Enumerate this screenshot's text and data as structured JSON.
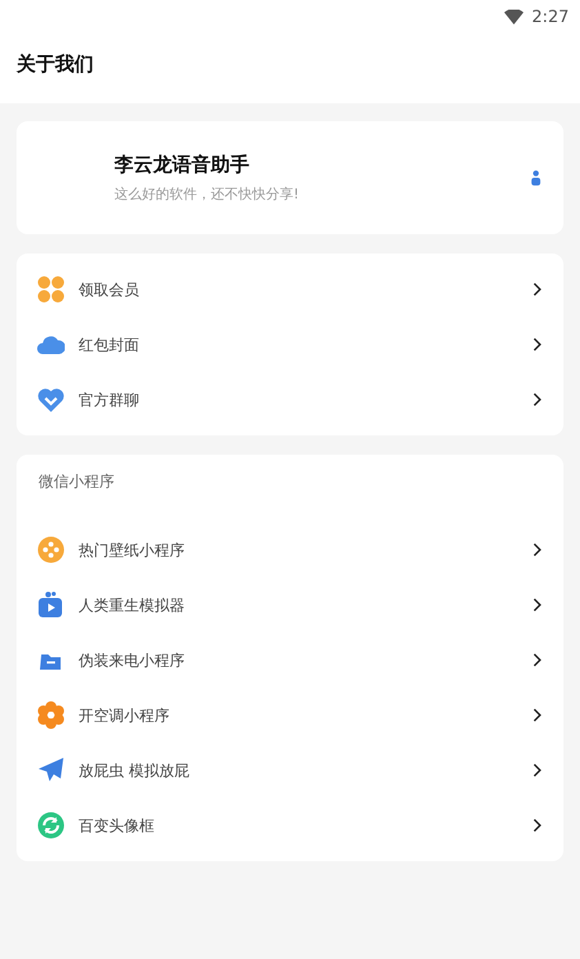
{
  "status_bar": {
    "time": "2:27"
  },
  "header": {
    "title": "关于我们"
  },
  "app_card": {
    "name": "李云龙语音助手",
    "tagline": "这么好的软件，还不快快分享!"
  },
  "menu": [
    {
      "label": "领取会员"
    },
    {
      "label": "红包封面"
    },
    {
      "label": "官方群聊"
    }
  ],
  "mini_programs": {
    "title": "微信小程序",
    "items": [
      {
        "label": "热门壁纸小程序"
      },
      {
        "label": "人类重生模拟器"
      },
      {
        "label": "伪装来电小程序"
      },
      {
        "label": "开空调小程序"
      },
      {
        "label": "放屁虫 模拟放屁"
      },
      {
        "label": "百变头像框"
      }
    ]
  }
}
